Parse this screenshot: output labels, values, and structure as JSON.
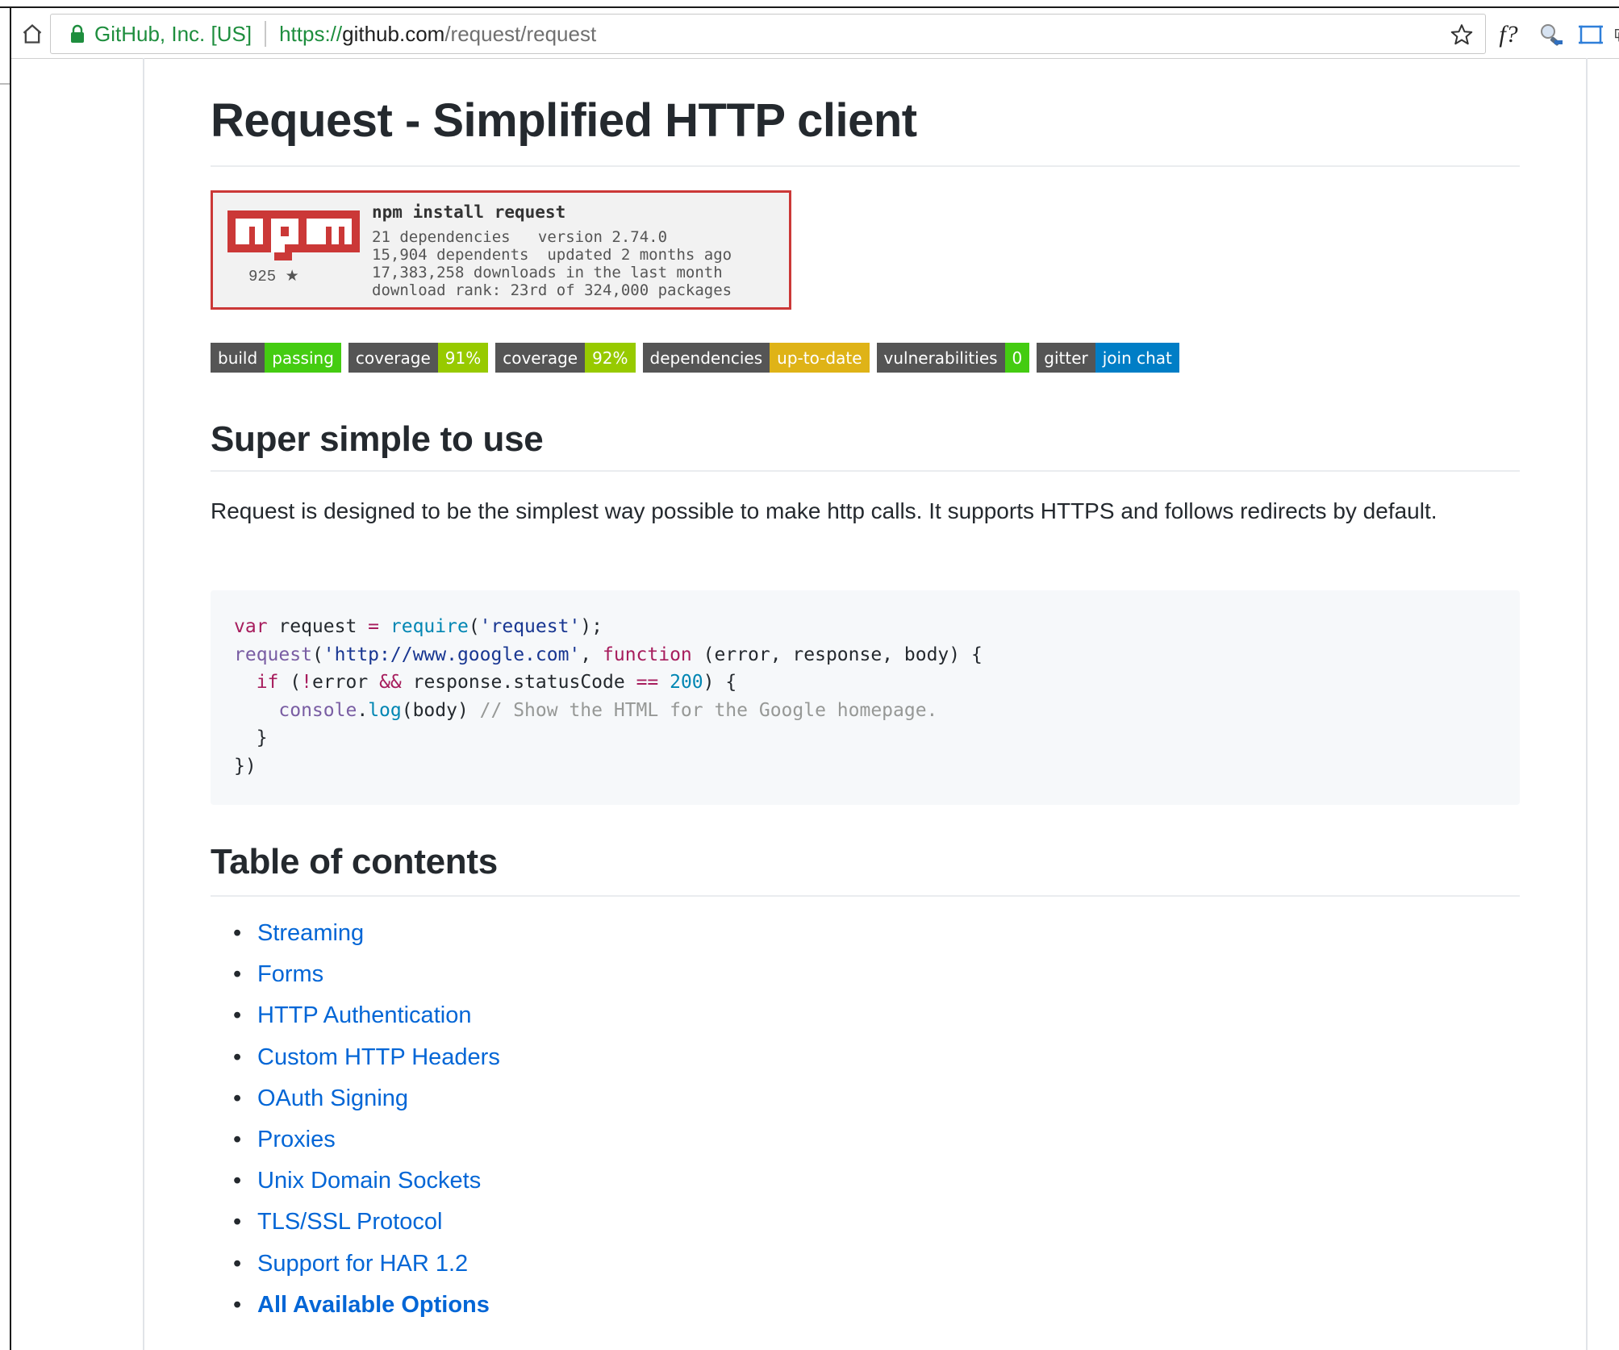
{
  "browser": {
    "site_identity": "GitHub, Inc. [US]",
    "url_scheme": "https://",
    "url_host": "github.com",
    "url_path": "/request/request",
    "extension_f_label": "f?",
    "icons": [
      "home-icon",
      "lock-icon",
      "star-icon",
      "magnifier-extension-icon",
      "screenshot-extension-icon"
    ]
  },
  "page": {
    "title": "Request - Simplified HTTP client",
    "npm_badge": {
      "logo_text": "npm",
      "stars": "925 ★",
      "command": "npm install request",
      "lines": [
        "21 dependencies   version 2.74.0",
        "15,904 dependents  updated 2 months ago",
        "17,383,258 downloads in the last month",
        "download rank: 23rd of 324,000 packages"
      ]
    },
    "badges": [
      {
        "label": "build",
        "value": "passing",
        "color": "#4c1"
      },
      {
        "label": "coverage",
        "value": "91%",
        "color": "#97ca00"
      },
      {
        "label": "coverage",
        "value": "92%",
        "color": "#97ca00"
      },
      {
        "label": "dependencies",
        "value": "up-to-date",
        "color": "#dfb317"
      },
      {
        "label": "vulnerabilities",
        "value": "0",
        "color": "#4c1"
      },
      {
        "label": "gitter",
        "value": "join chat",
        "color": "#007ec6"
      }
    ],
    "section1_heading": "Super simple to use",
    "section1_paragraph": "Request is designed to be the simplest way possible to make http calls. It supports HTTPS and follows redirects by default.",
    "code_tokens": {
      "kw_var": "var",
      "id_request": " request ",
      "op_eq": "=",
      "fn_require": " require",
      "p_open": "(",
      "str_request": "'request'",
      "p_close_semi": ");",
      "fn_request": "request",
      "str_url": "'http://www.google.com'",
      "comma": ", ",
      "kw_function": "function",
      "params": " (error, response, body) {",
      "kw_if": "if",
      "cond_a": " (",
      "op_not": "!",
      "cond_b": "error ",
      "op_and": "&&",
      "cond_c": " response.statusCode ",
      "op_eqeq": "==",
      "num_200": " 200",
      "cond_d": ") {",
      "obj_console": "console",
      "dot": ".",
      "fn_log": "log",
      "log_args": "(body) ",
      "comment": "// Show the HTML for the Google homepage.",
      "close_inner": "}",
      "close_outer": "})"
    },
    "section2_heading": "Table of contents",
    "toc": [
      "Streaming",
      "Forms",
      "HTTP Authentication",
      "Custom HTTP Headers",
      "OAuth Signing",
      "Proxies",
      "Unix Domain Sockets",
      "TLS/SSL Protocol",
      "Support for HAR 1.2",
      "All Available Options"
    ]
  }
}
